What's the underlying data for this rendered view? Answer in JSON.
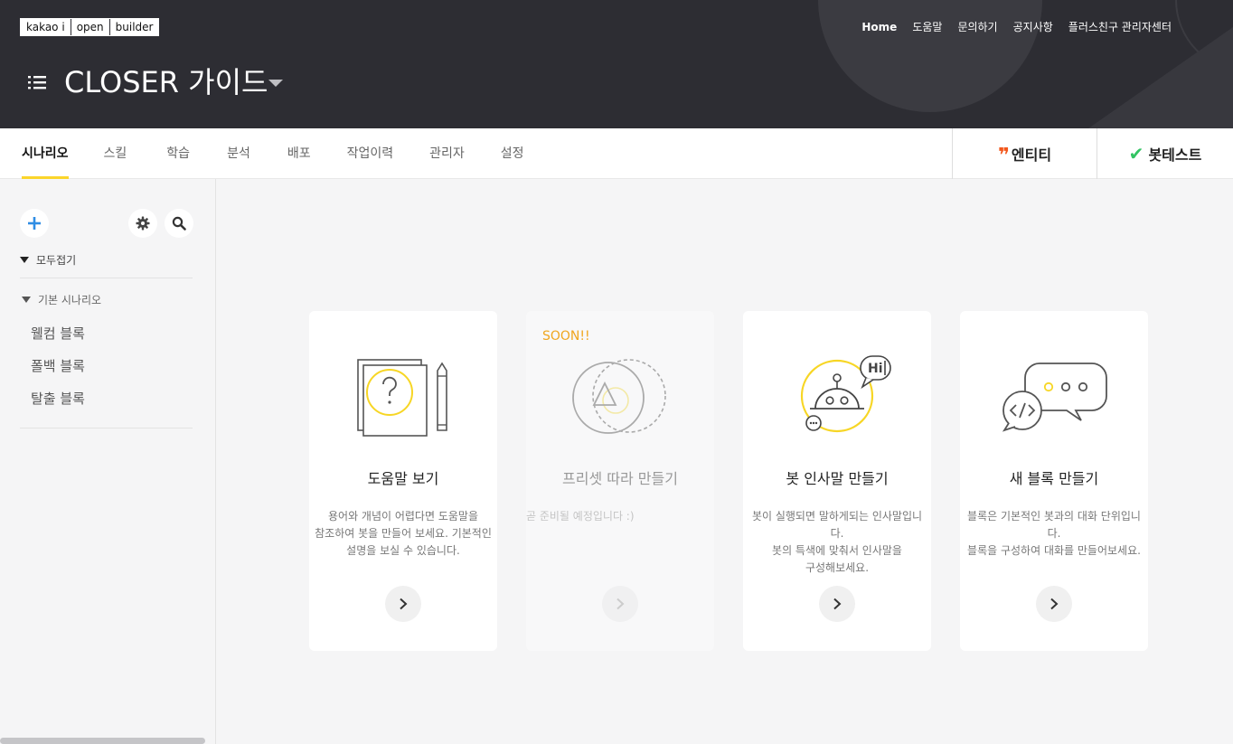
{
  "header": {
    "logo_parts": [
      "kakao i",
      "open",
      "builder"
    ],
    "nav": [
      "Home",
      "도움말",
      "문의하기",
      "공지사항",
      "플러스친구 관리자센터"
    ],
    "bot_name": "CLOSER 가이드"
  },
  "tabs": [
    "시나리오",
    "스킬",
    "학습",
    "분석",
    "배포",
    "작업이력",
    "관리자",
    "설정"
  ],
  "tools": {
    "entity_label": "엔티티",
    "bottest_label": "봇테스트"
  },
  "sidebar": {
    "fold_all_label": "모두접기",
    "group_label": "기본 시나리오",
    "blocks": [
      "웰컴 블록",
      "폴백 블록",
      "탈출 블록"
    ]
  },
  "cards": [
    {
      "title": "도움말 보기",
      "desc": [
        "용어와 개념이 어렵다면 도움말을",
        "참조하여 봇을 만들어 보세요. 기본적인",
        "설명을 보실 수 있습니다."
      ]
    },
    {
      "badge": "SOON!!",
      "title": "프리셋 따라 만들기",
      "desc": [
        "곧 준비될 예정입니다 :)"
      ]
    },
    {
      "title": "봇 인사말 만들기",
      "desc": [
        "봇이 실행되면 말하게되는 인사말입니다.",
        "봇의 특색에 맞춰서 인사말을",
        "구성해보세요."
      ]
    },
    {
      "title": "새 블록 만들기",
      "desc": [
        "블록은 기본적인 봇과의 대화 단위입니다.",
        "블록을 구성하여 대화를 만들어보세요."
      ]
    }
  ],
  "colors": {
    "header_bg": "#2d2d33",
    "tab_accent": "#fbd52b",
    "entity_accent": "#f2571c",
    "bottest_accent": "#33c463",
    "soon_accent": "#f0a61e",
    "icon_yellow": "#f7d625"
  },
  "icons": {
    "menu": "list-menu-icon",
    "add": "plus-icon",
    "settings": "gear-icon",
    "search": "search-icon",
    "card_help": "help-document-icon",
    "card_preset": "preset-shapes-icon",
    "card_greeting": "bot-greeting-icon",
    "card_new_block": "chat-code-icon",
    "arrow": "chevron-right-icon"
  }
}
